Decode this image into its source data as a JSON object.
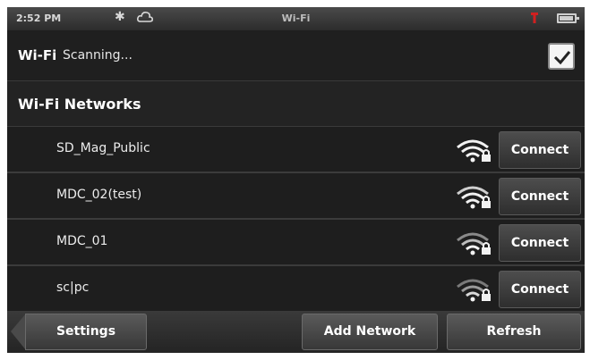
{
  "status_bar": {
    "time": "2:52 PM",
    "title": "Wi-Fi",
    "icons": [
      "bluetooth-icon",
      "cloud-icon",
      "alert-icon",
      "battery-icon"
    ]
  },
  "wifi": {
    "label": "Wi-Fi",
    "status": "Scanning...",
    "enabled": true
  },
  "section": {
    "title": "Wi-Fi Networks"
  },
  "networks": [
    {
      "ssid": "SD_Mag_Public",
      "signal": "wifi-locked-icon",
      "action": "Connect"
    },
    {
      "ssid": "MDC_02(test)",
      "signal": "wifi-locked-icon",
      "action": "Connect"
    },
    {
      "ssid": "MDC_01",
      "signal": "wifi-locked-icon",
      "action": "Connect"
    },
    {
      "ssid": "sc|pc",
      "signal": "wifi-locked-icon",
      "action": "Connect"
    }
  ],
  "bottom_bar": {
    "settings": "Settings",
    "add_network": "Add Network",
    "refresh": "Refresh"
  },
  "colors": {
    "background": "#1c1c1c",
    "button": "#3d3d3d",
    "alert": "#d02020"
  }
}
